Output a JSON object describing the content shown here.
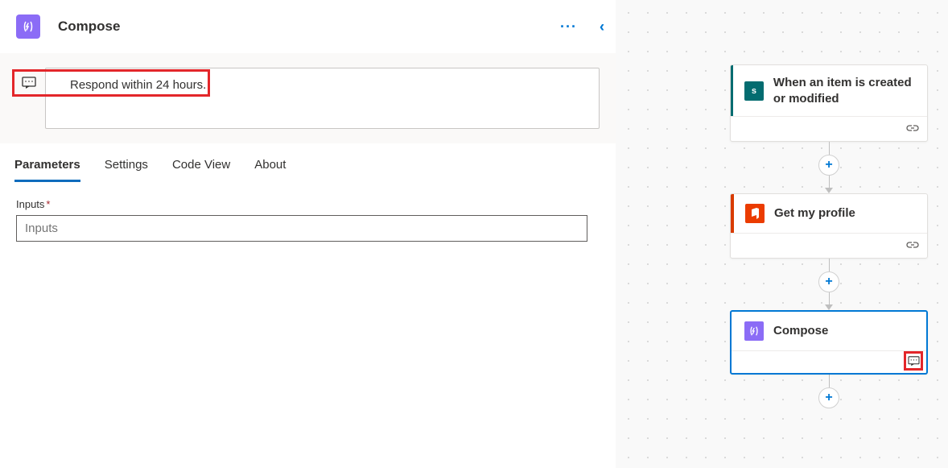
{
  "header": {
    "title": "Compose"
  },
  "note": {
    "text": "Respond within 24 hours."
  },
  "tabs": {
    "parameters": "Parameters",
    "settings": "Settings",
    "codeview": "Code View",
    "about": "About"
  },
  "form": {
    "inputs_label": "Inputs",
    "inputs_placeholder": "Inputs",
    "inputs_value": ""
  },
  "flow": {
    "card1": {
      "title": "When an item is created or modified"
    },
    "card2": {
      "title": "Get my profile"
    },
    "card3": {
      "title": "Compose"
    }
  }
}
